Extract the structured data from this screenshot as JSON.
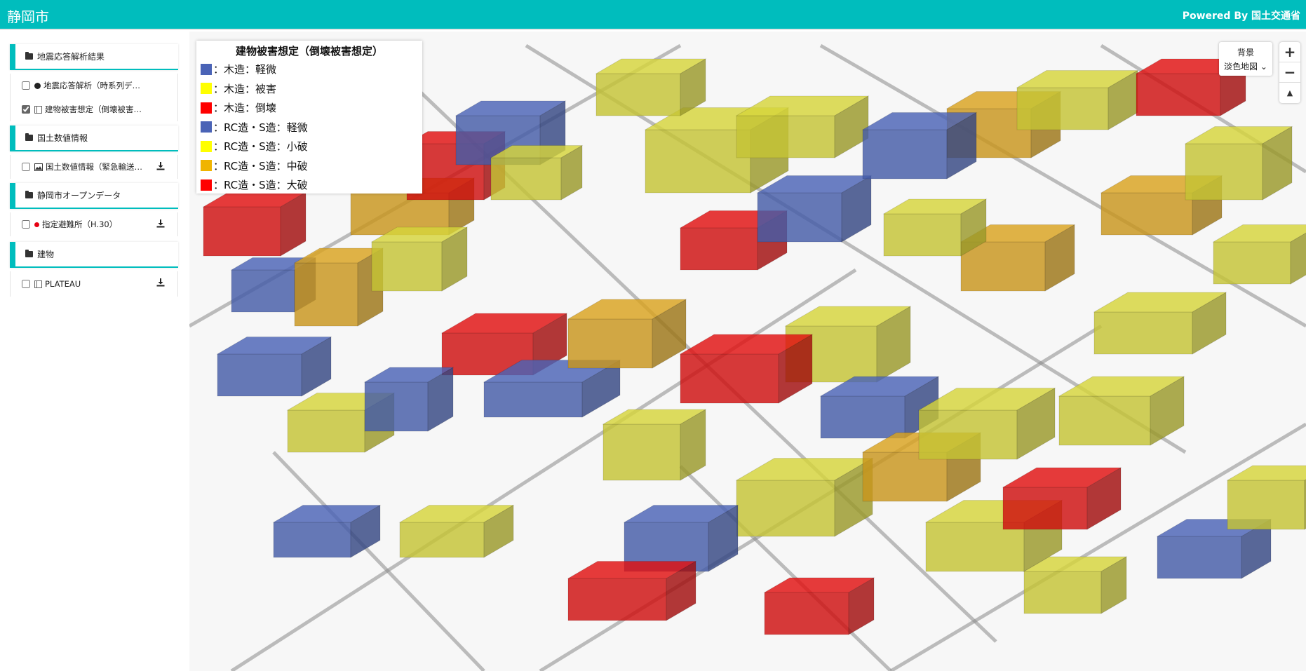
{
  "header": {
    "title": "静岡市",
    "powered_by": "Powered By 国土交通省"
  },
  "sidebar": {
    "sections": [
      {
        "label": "地震応答解析結果",
        "items": [
          {
            "label": "地震応答解析（時系列デ…",
            "checked": false,
            "icon": "dot-icon"
          },
          {
            "label": "建物被害想定（倒壊被害…",
            "checked": true,
            "icon": "building-icon"
          }
        ]
      },
      {
        "label": "国土数値情報",
        "items": [
          {
            "label": "国土数値情報（緊急輸送…",
            "checked": false,
            "icon": "image-icon",
            "download": true
          }
        ]
      },
      {
        "label": "静岡市オープンデータ",
        "items": [
          {
            "label": "指定避難所（H.30）",
            "checked": false,
            "icon": "red-dot-icon",
            "download": true
          }
        ]
      },
      {
        "label": "建物",
        "items": [
          {
            "label": "PLATEAU",
            "checked": false,
            "icon": "building-icon",
            "download": true
          }
        ]
      }
    ]
  },
  "legend": {
    "title": "建物被害想定（倒壊被害想定）",
    "entries": [
      {
        "label": "：木造：軽微",
        "color": "#4a63b6"
      },
      {
        "label": "：木造：被害",
        "color": "#ffff00"
      },
      {
        "label": "：木造：倒壊",
        "color": "#ff0000"
      },
      {
        "label": "：RC造・S造：軽微",
        "color": "#4a63b6"
      },
      {
        "label": "：RC造・S造：小破",
        "color": "#ffff00"
      },
      {
        "label": "：RC造・S造：中破",
        "color": "#f0b400"
      },
      {
        "label": "：RC造・S造：大破",
        "color": "#ff0000"
      }
    ]
  },
  "basemap": {
    "label": "背景",
    "selected": "淡色地図"
  },
  "zoom": {
    "in": "+",
    "out": "−",
    "compass": "▲"
  },
  "colors": {
    "accent": "#00bdbd",
    "blue": "#4a63b6",
    "yellow": "#d6d43a",
    "orange": "#d9a21e",
    "red": "#e01010"
  }
}
